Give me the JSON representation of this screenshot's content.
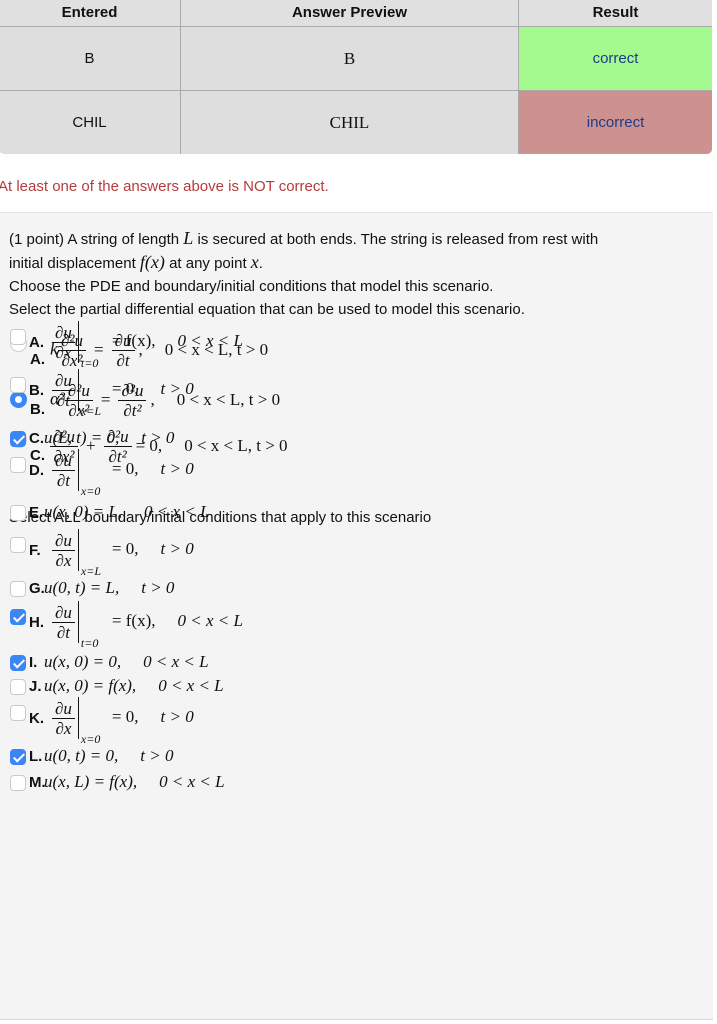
{
  "results_table": {
    "headers": [
      "Entered",
      "Answer Preview",
      "Result"
    ],
    "rows": [
      {
        "entered": "B",
        "preview": "B",
        "result": "correct",
        "result_color": "#a5fa8f"
      },
      {
        "entered": "CHIL",
        "preview": "CHIL",
        "result": "incorrect",
        "result_color": "#cd918f"
      }
    ]
  },
  "warning": "At least one of the answers above is NOT correct.",
  "problem": {
    "points": "(1 point)",
    "statement_a": "A string of length",
    "var_L": "L",
    "statement_b": "is secured at both ends. The string is released from rest with",
    "statement_c": "initial displacement",
    "f_x": "f(x)",
    "statement_d": "at any point",
    "var_x": "x",
    "line3": "Choose the PDE and boundary/initial conditions that model this scenario.",
    "line4": "Select the partial differential equation that can be used to model this scenario."
  },
  "pde_options": [
    {
      "label": "A.",
      "coef": "k",
      "lhs_num": "∂²u",
      "lhs_den": "∂x²",
      "op": "=",
      "rhs_num": "∂u",
      "rhs_den": "∂t",
      "tail": ",",
      "domain": "0 < x < L, t > 0",
      "selected": false
    },
    {
      "label": "B.",
      "coef": "α²",
      "lhs_num": "∂²u",
      "lhs_den": "∂x²",
      "op": "=",
      "rhs_num": "∂²u",
      "rhs_den": "∂t²",
      "tail": ",",
      "domain": "0 < x < L, t > 0",
      "selected": true
    },
    {
      "label": "C.",
      "coef": "",
      "lhs_num": "∂²u",
      "lhs_den": "∂x²",
      "op": "+",
      "rhs_num": "∂²u",
      "rhs_den": "∂t²",
      "tail": "= 0,",
      "domain": "0 < x < L, t > 0",
      "selected": false
    }
  ],
  "bc_prompt": "Select ALL boundary/initial conditions that apply to this scenario",
  "bc_options": [
    {
      "label": "A.",
      "num": "∂u",
      "den": "∂x",
      "sub": "t=0",
      "rhs": "= f(x),",
      "domain": "0 < x < L",
      "checked": false
    },
    {
      "label": "B.",
      "num": "∂u",
      "den": "∂t",
      "sub": "x=L",
      "rhs": "= 0,",
      "domain": "t > 0",
      "checked": false
    },
    {
      "label": "C.",
      "text": "u(L, t) = 0,",
      "domain": "t > 0",
      "checked": true
    },
    {
      "label": "D.",
      "num": "∂u",
      "den": "∂t",
      "sub": "x=0",
      "rhs": "= 0,",
      "domain": "t > 0",
      "checked": false
    },
    {
      "label": "E.",
      "text": "u(x, 0) = L,",
      "domain": "0 < x < L",
      "checked": false
    },
    {
      "label": "F.",
      "num": "∂u",
      "den": "∂x",
      "sub": "x=L",
      "rhs": "= 0,",
      "domain": "t > 0",
      "checked": false
    },
    {
      "label": "G.",
      "text": "u(0, t) = L,",
      "domain": "t > 0",
      "checked": false
    },
    {
      "label": "H.",
      "num": "∂u",
      "den": "∂t",
      "sub": "t=0",
      "rhs": "= f(x),",
      "domain": "0 < x < L",
      "checked": true
    },
    {
      "label": "I.",
      "text": "u(x, 0) = 0,",
      "domain": "0 < x < L",
      "checked": true
    },
    {
      "label": "J.",
      "text": "u(x, 0) = f(x),",
      "domain": "0 < x < L",
      "checked": false
    },
    {
      "label": "K.",
      "num": "∂u",
      "den": "∂x",
      "sub": "x=0",
      "rhs": "= 0,",
      "domain": "t > 0",
      "checked": false
    },
    {
      "label": "L.",
      "text": "u(0, t) = 0,",
      "domain": "t > 0",
      "checked": true
    },
    {
      "label": "M.",
      "text": "u(x, L) = f(x),",
      "domain": "0 < x < L",
      "checked": false
    }
  ]
}
